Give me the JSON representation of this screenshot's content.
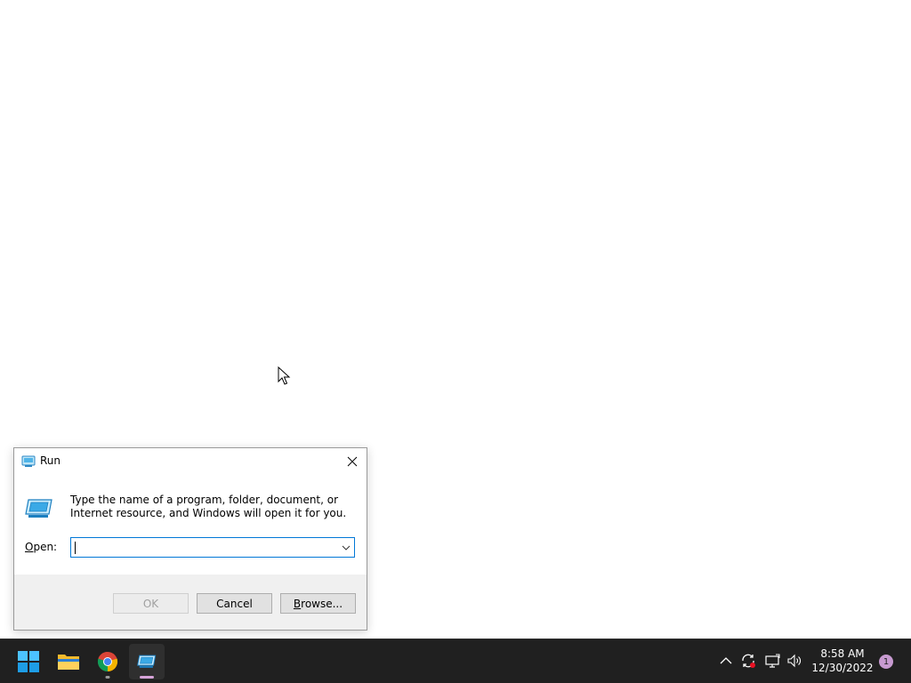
{
  "dialog": {
    "title": "Run",
    "title_icon": "run-icon",
    "close_icon": "close-icon",
    "description": "Type the name of a program, folder, document, or Internet resource, and Windows will open it for you.",
    "open_label_underline": "O",
    "open_label_rest": "pen:",
    "open_value": "",
    "buttons": {
      "ok": "OK",
      "cancel": "Cancel",
      "browse_underline": "B",
      "browse_rest": "rowse..."
    }
  },
  "taskbar": {
    "items": [
      {
        "name": "start",
        "icon": "windows-logo-icon"
      },
      {
        "name": "file-explorer",
        "icon": "folder-icon"
      },
      {
        "name": "chrome",
        "icon": "chrome-icon"
      },
      {
        "name": "run",
        "icon": "run-icon"
      }
    ],
    "tray": {
      "time": "8:58 AM",
      "date": "12/30/2022",
      "notification_count": "1"
    }
  },
  "colors": {
    "accent": "#0078d7",
    "taskbar_bg": "#202020",
    "dialog_bg": "#f0f0f0"
  }
}
